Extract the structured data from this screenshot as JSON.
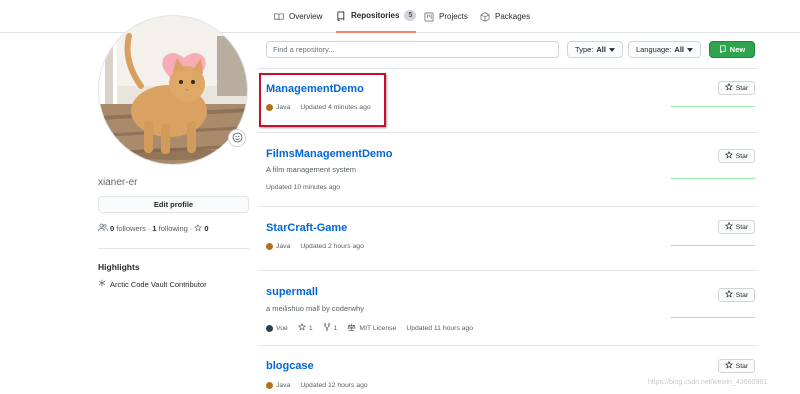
{
  "tabs": [
    {
      "label": "Overview",
      "icon": "book-open-icon"
    },
    {
      "label": "Repositories",
      "icon": "repo-icon",
      "count": "5"
    },
    {
      "label": "Projects",
      "icon": "project-board-icon"
    },
    {
      "label": "Packages",
      "icon": "package-icon"
    }
  ],
  "profile": {
    "username": "xianer-er",
    "edit_label": "Edit profile",
    "followers_count": "0",
    "followers_label": "followers",
    "following_count": "1",
    "following_label": "following",
    "stars_count": "0",
    "highlights_title": "Highlights",
    "highlight_item": "Arctic Code Vault Contributor"
  },
  "filters": {
    "search_placeholder": "Find a repository...",
    "type_label": "Type:",
    "type_value": "All",
    "language_label": "Language:",
    "language_value": "All",
    "new_label": "New"
  },
  "repos": [
    {
      "name": "ManagementDemo",
      "description": "",
      "language": "Java",
      "language_color": "#b07219",
      "updated": "Updated 4 minutes ago"
    },
    {
      "name": "FilmsManagementDemo",
      "description": "A film management system",
      "language": "",
      "updated": "Updated 10 minutes ago"
    },
    {
      "name": "StarCraft-Game",
      "description": "",
      "language": "Java",
      "language_color": "#b07219",
      "updated": "Updated 2 hours ago"
    },
    {
      "name": "supermall",
      "description": "a meilishuo mall by coderwhy",
      "language": "Vue",
      "language_color": "#2c3e50",
      "stars": "1",
      "forks": "1",
      "license": "MIT License",
      "updated": "Updated 11 hours ago"
    },
    {
      "name": "blogcase",
      "description": "",
      "language": "Java",
      "language_color": "#b07219",
      "updated": "Updated 12 hours ago"
    }
  ],
  "star_label": "Star",
  "watermark": "https://blog.csdn.net/weixin_43660981",
  "colors": {
    "accent_tab": "#f9826c",
    "link": "#0366d6",
    "new_button": "#2ea44f",
    "highlight_box": "#c8102e"
  }
}
